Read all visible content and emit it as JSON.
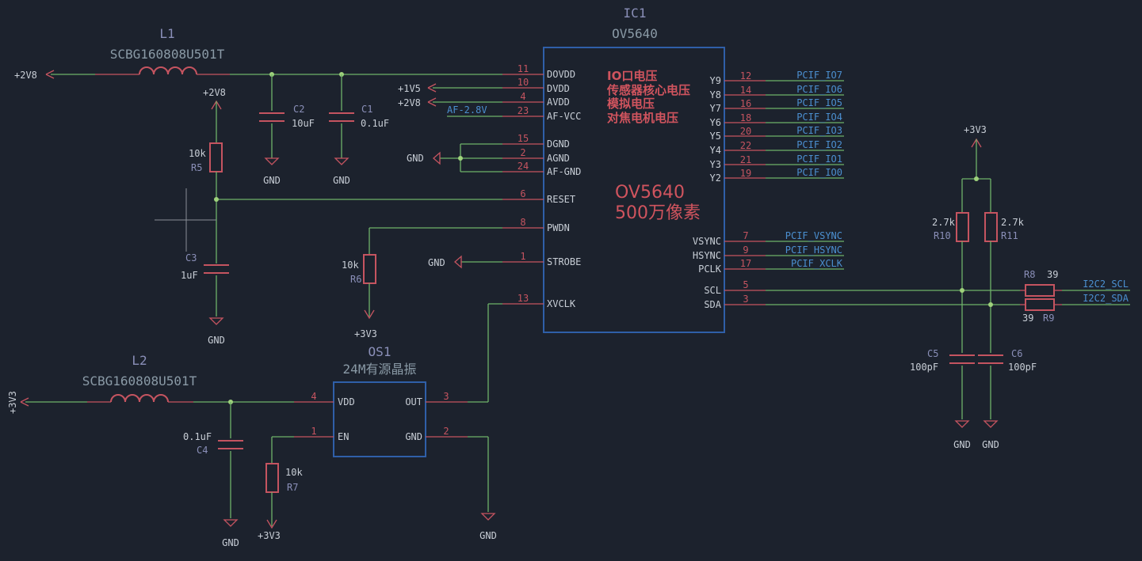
{
  "ic1": {
    "ref": "IC1",
    "value": "OV5640",
    "note_lines": [
      "IO口电压",
      "传感器核心电压",
      "模拟电压",
      "对焦电机电压"
    ],
    "big_title": "OV5640",
    "big_subtitle": "500万像素",
    "left_pins": [
      {
        "num": "11",
        "name": "DOVDD"
      },
      {
        "num": "10",
        "name": "DVDD"
      },
      {
        "num": "4",
        "name": "AVDD"
      },
      {
        "num": "23",
        "name": "AF-VCC"
      },
      {
        "num": "15",
        "name": "DGND"
      },
      {
        "num": "2",
        "name": "AGND"
      },
      {
        "num": "24",
        "name": "AF-GND"
      },
      {
        "num": "6",
        "name": "RESET"
      },
      {
        "num": "8",
        "name": "PWDN"
      },
      {
        "num": "1",
        "name": "STROBE"
      },
      {
        "num": "13",
        "name": "XVCLK"
      }
    ],
    "right_pins": [
      {
        "num": "12",
        "name": "Y9",
        "net": "PCIF_IO7"
      },
      {
        "num": "14",
        "name": "Y8",
        "net": "PCIF_IO6"
      },
      {
        "num": "16",
        "name": "Y7",
        "net": "PCIF_IO5"
      },
      {
        "num": "18",
        "name": "Y6",
        "net": "PCIF_IO4"
      },
      {
        "num": "20",
        "name": "Y5",
        "net": "PCIF_IO3"
      },
      {
        "num": "22",
        "name": "Y4",
        "net": "PCIF_IO2"
      },
      {
        "num": "21",
        "name": "Y3",
        "net": "PCIF_IO1"
      },
      {
        "num": "19",
        "name": "Y2",
        "net": "PCIF_IO0"
      },
      {
        "num": "7",
        "name": "VSYNC",
        "net": "PCIF_VSYNC"
      },
      {
        "num": "9",
        "name": "HSYNC",
        "net": "PCIF_HSYNC"
      },
      {
        "num": "17",
        "name": "PCLK",
        "net": "PCIF_XCLK"
      },
      {
        "num": "5",
        "name": "SCL",
        "net": ""
      },
      {
        "num": "3",
        "name": "SDA",
        "net": ""
      }
    ]
  },
  "os1": {
    "ref": "OS1",
    "value": "24M有源晶振",
    "pins": [
      {
        "num": "4",
        "name": "VDD"
      },
      {
        "num": "1",
        "name": "EN"
      },
      {
        "num": "3",
        "name": "OUT"
      },
      {
        "num": "2",
        "name": "GND"
      }
    ]
  },
  "inductors": {
    "l1": {
      "ref": "L1",
      "value": "SCBG160808U501T"
    },
    "l2": {
      "ref": "L2",
      "value": "SCBG160808U501T"
    }
  },
  "resistors": {
    "r5": {
      "ref": "R5",
      "value": "10k"
    },
    "r6": {
      "ref": "R6",
      "value": "10k"
    },
    "r7": {
      "ref": "R7",
      "value": "10k"
    },
    "r8": {
      "ref": "R8",
      "value": "39"
    },
    "r9": {
      "ref": "R9",
      "value": "39"
    },
    "r10": {
      "ref": "R10",
      "value": "2.7k"
    },
    "r11": {
      "ref": "R11",
      "value": "2.7k"
    }
  },
  "capacitors": {
    "c1": {
      "ref": "C1",
      "value": "0.1uF"
    },
    "c2": {
      "ref": "C2",
      "value": "10uF"
    },
    "c3": {
      "ref": "C3",
      "value": "1uF"
    },
    "c4": {
      "ref": "C4",
      "value": "0.1uF"
    },
    "c5": {
      "ref": "C5",
      "value": "100pF"
    },
    "c6": {
      "ref": "C6",
      "value": "100pF"
    }
  },
  "power": {
    "p2v8": "+2V8",
    "p1v5": "+1V5",
    "p3v3": "+3V3",
    "gnd": "GND",
    "af": "AF-2.8V"
  },
  "nets": {
    "scl": "I2C2_SCL",
    "sda": "I2C2_SDA"
  },
  "colors": {
    "background": "#1c222d",
    "wire": "#6eb26a",
    "component": "#c55460",
    "ic_outline": "#2f5fa8",
    "label_net": "#4b8fd0"
  }
}
